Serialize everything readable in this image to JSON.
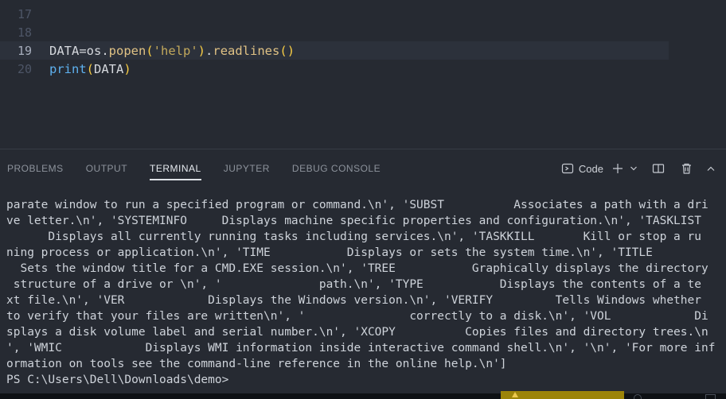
{
  "editor": {
    "lines": [
      {
        "num": "17",
        "active": false,
        "tokens": []
      },
      {
        "num": "18",
        "active": false,
        "tokens": []
      },
      {
        "num": "19",
        "active": true,
        "tokens": [
          {
            "text": "DATA=os.",
            "type": "plain"
          },
          {
            "text": "popen",
            "type": "func"
          },
          {
            "text": "(",
            "type": "paren"
          },
          {
            "text": "'help'",
            "type": "string"
          },
          {
            "text": ")",
            "type": "paren"
          },
          {
            "text": ".",
            "type": "plain"
          },
          {
            "text": "readlines",
            "type": "func"
          },
          {
            "text": "()",
            "type": "paren"
          }
        ]
      },
      {
        "num": "20",
        "active": false,
        "tokens": [
          {
            "text": "print",
            "type": "keyword"
          },
          {
            "text": "(",
            "type": "paren"
          },
          {
            "text": "DATA",
            "type": "plain"
          },
          {
            "text": ")",
            "type": "paren"
          }
        ]
      }
    ]
  },
  "panel": {
    "tabs": [
      {
        "label": "PROBLEMS",
        "active": false
      },
      {
        "label": "OUTPUT",
        "active": false
      },
      {
        "label": "TERMINAL",
        "active": true
      },
      {
        "label": "JUPYTER",
        "active": false
      },
      {
        "label": "DEBUG CONSOLE",
        "active": false
      }
    ],
    "shell_label": "Code",
    "action_icons": [
      "terminal-icon",
      "plus-icon",
      "chevron-down-icon",
      "split-editor-icon",
      "trash-icon",
      "chevron-up-icon"
    ]
  },
  "terminal": {
    "lines": [
      "parate window to run a specified program or command.\\n', 'SUBST          Associates a path with a dri",
      "ve letter.\\n', 'SYSTEMINFO     Displays machine specific properties and configuration.\\n', 'TASKLIST",
      "      Displays all currently running tasks including services.\\n', 'TASKKILL       Kill or stop a ru",
      "ning process or application.\\n', 'TIME           Displays or sets the system time.\\n', 'TITLE",
      "  Sets the window title for a CMD.EXE session.\\n', 'TREE           Graphically displays the directory",
      " structure of a drive or \\n', '              path.\\n', 'TYPE           Displays the contents of a te",
      "xt file.\\n', 'VER            Displays the Windows version.\\n', 'VERIFY         Tells Windows whether",
      "to verify that your files are written\\n', '               correctly to a disk.\\n', 'VOL            Di",
      "splays a disk volume label and serial number.\\n', 'XCOPY          Copies files and directory trees.\\n",
      "', 'WMIC            Displays WMI information inside interactive command shell.\\n', '\\n', 'For more inf",
      "ormation on tools see the command-line reference in the online help.\\n']",
      "PS C:\\Users\\Dell\\Downloads\\demo>"
    ]
  },
  "colors": {
    "editor_bg": "#262a32",
    "active_line_band": "#2c313b",
    "tab_active": "#e6eaef",
    "tab_inactive": "#8d939c",
    "terminal_text": "#ced3da",
    "token_function": "#e0c285",
    "token_paren": "#f7cc45",
    "token_string": "#c3a95c",
    "token_keyword": "#5eb1ef",
    "warning_gold": "#9c8409"
  }
}
